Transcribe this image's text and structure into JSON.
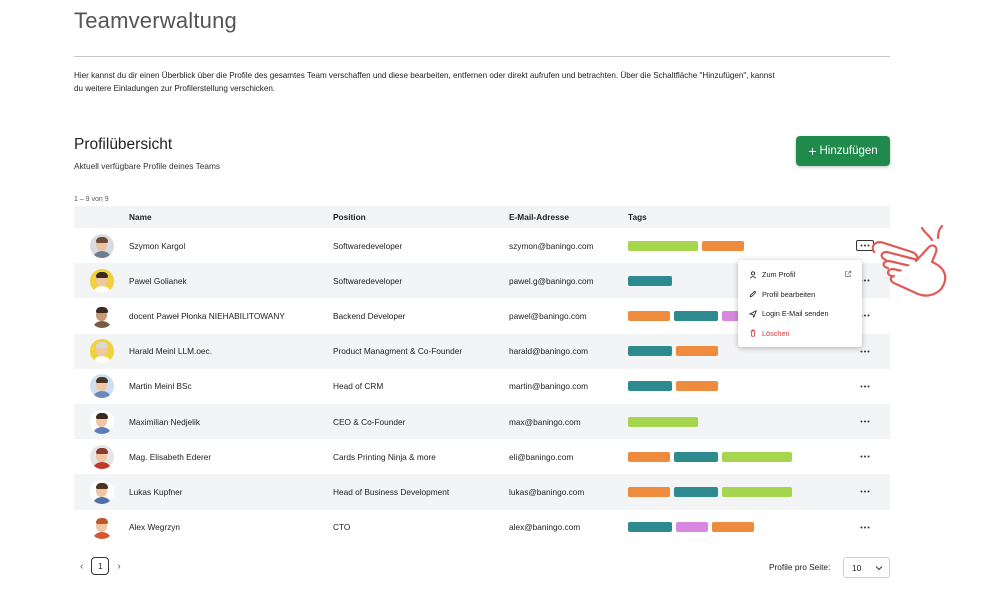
{
  "page": {
    "title": "Teamverwaltung",
    "intro_line1": "Hier kannst du dir einen Überblick über die Profile des gesamtes Team verschaffen und diese bearbeiten, entfernen oder direkt aufrufen und betrachten. Über die Schaltfläche \"Hinzufügen\", kannst",
    "intro_line2": "du weitere Einladungen zur Profilerstellung verschicken."
  },
  "overview": {
    "title": "Profilübersicht",
    "subtitle": "Aktuell verfügbare Profile deines Teams",
    "add_button": "Hinzufügen",
    "range": "1 – 9 von 9"
  },
  "table": {
    "headers": {
      "name": "Name",
      "position": "Position",
      "email": "E-Mail-Adresse",
      "tags": "Tags"
    },
    "rows": [
      {
        "name": "Szymon Kargol",
        "position": "Softwaredeveloper",
        "email": "szymon@baningo.com",
        "tags": [
          "green",
          "orange"
        ],
        "avatar": {
          "skin": "#e8c3a3",
          "hair": "#6b4b34",
          "shirt": "#6f7f8f",
          "bg": "#d9dde2"
        },
        "menu_open": true
      },
      {
        "name": "Pawel Golianek",
        "position": "Softwaredeveloper",
        "email": "pawel.g@baningo.com",
        "tags": [
          "teal"
        ],
        "avatar": {
          "skin": "#efc7a6",
          "hair": "#3a2a20",
          "shirt": "#ffffff",
          "bg": "#f1d23b"
        }
      },
      {
        "name": "docent Paweł Płonka NIEHABILITOWANY",
        "position": "Backend Developer",
        "email": "pawel@baningo.com",
        "tags": [
          "orange",
          "teal",
          "pink"
        ],
        "avatar": {
          "skin": "#c79a74",
          "hair": "#3b2b1e",
          "shirt": "#7a5a42",
          "bg": "#ffffff"
        }
      },
      {
        "name": "Harald Meinl LLM.oec.",
        "position": "Product Managment & Co-Founder",
        "email": "harald@baningo.com",
        "tags": [
          "teal",
          "orange"
        ],
        "avatar": {
          "skin": "#efc9a8",
          "hair": "#d8d8d8",
          "shirt": "#ffffff",
          "bg": "#f1d23b"
        }
      },
      {
        "name": "Martin Meinl BSc",
        "position": "Head of CRM",
        "email": "martin@baningo.com",
        "tags": [
          "teal",
          "orange"
        ],
        "avatar": {
          "skin": "#efc7a6",
          "hair": "#4a3526",
          "shirt": "#6b88b8",
          "bg": "#cfe0f2"
        }
      },
      {
        "name": "Maximilian Nedjelik",
        "position": "CEO & Co-Founder",
        "email": "max@baningo.com",
        "tags": [
          "green"
        ],
        "avatar": {
          "skin": "#efc7a6",
          "hair": "#3a2a20",
          "shirt": "#5b7db5",
          "bg": "#ffffff"
        }
      },
      {
        "name": "Mag. Elisabeth Ederer",
        "position": "Cards Printing Ninja & more",
        "email": "eli@baningo.com",
        "tags": [
          "orange",
          "teal",
          "green"
        ],
        "avatar": {
          "skin": "#efc7a6",
          "hair": "#8b3a2e",
          "shirt": "#c0392b",
          "bg": "#e6e6e6"
        }
      },
      {
        "name": "Lukas Kupfner",
        "position": "Head of Business Development",
        "email": "lukas@baningo.com",
        "tags": [
          "orange",
          "teal",
          "green"
        ],
        "avatar": {
          "skin": "#efc7a6",
          "hair": "#4a3526",
          "shirt": "#4f6fa8",
          "bg": "#ffffff"
        }
      },
      {
        "name": "Alex Wegrzyn",
        "position": "CTO",
        "email": "alex@baningo.com",
        "tags": [
          "teal",
          "pink",
          "orange"
        ],
        "avatar": {
          "skin": "#efc7a6",
          "hair": "#c0562e",
          "shirt": "#d4572f",
          "bg": "#ffffff"
        }
      }
    ],
    "actions_icon": "more-horizontal-icon"
  },
  "context_menu": {
    "items": [
      {
        "label": "Zum Profil",
        "icon": "user-icon",
        "extra_icon": "external-link-icon"
      },
      {
        "label": "Profil bearbeiten",
        "icon": "pencil-icon"
      },
      {
        "label": "Login E-Mail senden",
        "icon": "send-icon"
      },
      {
        "label": "Löschen",
        "icon": "trash-icon",
        "danger": true
      }
    ]
  },
  "pagination": {
    "current_page": "1",
    "per_page_label": "Profile pro Seite:",
    "per_page_value": "10"
  },
  "colors": {
    "accent_green": "#1f8a4c",
    "tag_green": "#a6d64e",
    "tag_orange": "#ef8b3c",
    "tag_teal": "#2d8a8f",
    "tag_pink": "#d888e0",
    "danger": "#d43a3a",
    "hand_outline": "#e05a55"
  }
}
